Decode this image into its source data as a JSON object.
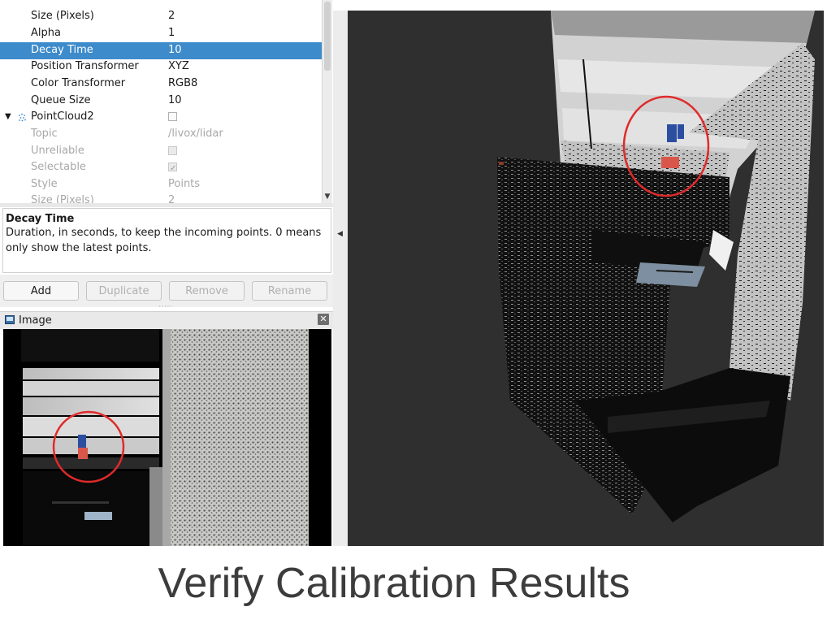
{
  "properties": {
    "rows": [
      {
        "label": "Size (Pixels)",
        "value": "2"
      },
      {
        "label": "Alpha",
        "value": "1"
      },
      {
        "label": "Decay Time",
        "value": "10"
      },
      {
        "label": "Position Transformer",
        "value": "XYZ"
      },
      {
        "label": "Color Transformer",
        "value": "RGB8"
      },
      {
        "label": "Queue Size",
        "value": "10"
      },
      {
        "label": "PointCloud2",
        "value": ""
      },
      {
        "label": "Topic",
        "value": "/livox/lidar"
      },
      {
        "label": "Unreliable",
        "value": ""
      },
      {
        "label": "Selectable",
        "value": ""
      },
      {
        "label": "Style",
        "value": "Points"
      },
      {
        "label": "Size (Pixels)",
        "value": "2"
      }
    ],
    "selected_row": "Decay Time",
    "pointcloud2_checked": false,
    "unreliable_checked": false,
    "selectable_checked": true
  },
  "description": {
    "title": "Decay Time",
    "body": "Duration, in seconds, to keep the incoming points. 0 means only show the latest points."
  },
  "buttons": {
    "add": "Add",
    "duplicate": "Duplicate",
    "remove": "Remove",
    "rename": "Rename"
  },
  "image_panel": {
    "title": "Image",
    "close_icon": "close-icon"
  },
  "colors": {
    "selection": "#3d8bcb",
    "highlight_circle": "#e02a2a",
    "view_background": "#2f2f2f"
  },
  "slide_title": "Verify Calibration Results"
}
